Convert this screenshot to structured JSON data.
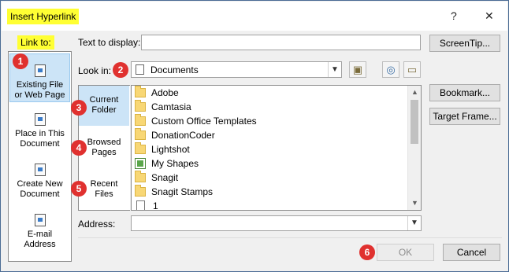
{
  "dialog": {
    "title": "Insert Hyperlink",
    "help_glyph": "?",
    "close_glyph": "✕"
  },
  "link_to": {
    "label": "Link to:",
    "items": [
      {
        "line1": "Existing File",
        "line2": "or Web Page",
        "icon": "existing-file-icon"
      },
      {
        "line1": "Place in This",
        "line2": "Document",
        "icon": "place-in-document-icon"
      },
      {
        "line1": "Create New",
        "line2": "Document",
        "icon": "create-new-document-icon"
      },
      {
        "line1": "E-mail",
        "line2": "Address",
        "icon": "email-address-icon"
      }
    ]
  },
  "text_to_display": {
    "label": "Text to display:",
    "value": ""
  },
  "screentip_label": "ScreenTip...",
  "look_in": {
    "label": "Look in:",
    "value": "Documents"
  },
  "browse": {
    "items": [
      {
        "line1": "Current",
        "line2": "Folder"
      },
      {
        "line1": "Browsed",
        "line2": "Pages"
      },
      {
        "line1": "Recent",
        "line2": "Files"
      }
    ]
  },
  "files": [
    {
      "name": "Adobe",
      "icon": "folder-icon"
    },
    {
      "name": "Camtasia",
      "icon": "folder-icon"
    },
    {
      "name": "Custom Office Templates",
      "icon": "folder-icon"
    },
    {
      "name": "DonationCoder",
      "icon": "folder-icon"
    },
    {
      "name": "Lightshot",
      "icon": "folder-icon"
    },
    {
      "name": "My Shapes",
      "icon": "shapes-folder-icon"
    },
    {
      "name": "Snagit",
      "icon": "folder-icon"
    },
    {
      "name": "Snagit Stamps",
      "icon": "folder-icon"
    },
    {
      "name": "1",
      "icon": "document-icon"
    }
  ],
  "bookmark_label": "Bookmark...",
  "target_frame_label": "Target Frame...",
  "address": {
    "label": "Address:",
    "value": ""
  },
  "ok_label": "OK",
  "cancel_label": "Cancel",
  "markers": [
    "1",
    "2",
    "3",
    "4",
    "5",
    "6"
  ],
  "colors": {
    "highlight": "#ffff33",
    "marker": "#e0312f",
    "selection": "#cce4f7"
  }
}
